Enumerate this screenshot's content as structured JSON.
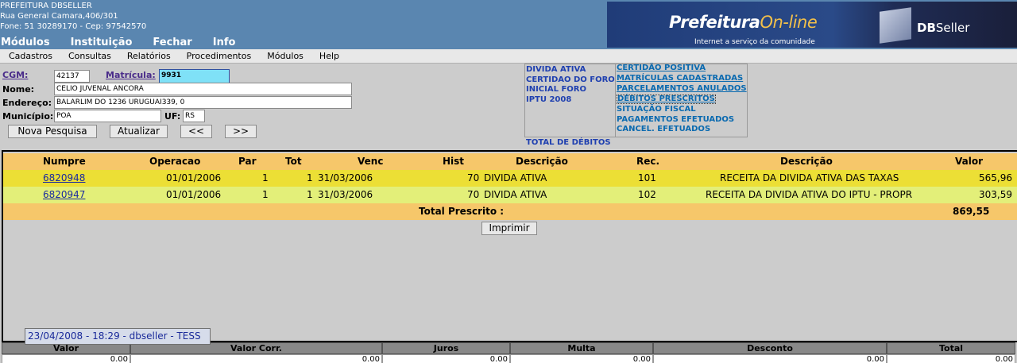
{
  "header": {
    "org_name": "PREFEITURA DBSELLER",
    "address": "Rua General Camara,406/301",
    "contact": "Fone: 51 30289170  -  Cep: 97542570",
    "menu": [
      "Módulos",
      "Instituição",
      "Fechar",
      "Info"
    ],
    "banner_logo_main": "Prefeitura",
    "banner_logo_accent": "On-line",
    "banner_tagline": "Internet a serviço da comunidade",
    "banner_brand_bold": "DB",
    "banner_brand_rest": "Seller"
  },
  "menubar": [
    "Cadastros",
    "Consultas",
    "Relatórios",
    "Procedimentos",
    "Módulos",
    "Help"
  ],
  "form": {
    "cgm_label": "CGM:",
    "cgm_value": "42137",
    "matricula_label": "Matrícula:",
    "matricula_value": "9931",
    "nome_label": "Nome:",
    "nome_value": "CELIO JUVENAL ANCORA",
    "endereco_label": "Endereço:",
    "endereco_value": "BALARLIM DO 1236 URUGUAI339, 0",
    "municipio_label": "Município:",
    "municipio_value": "POA",
    "uf_label": "UF:",
    "uf_value": "RS",
    "btn_nova": "Nova Pesquisa",
    "btn_atualizar": "Atualizar",
    "btn_prev": "<<",
    "btn_next": ">>"
  },
  "side": {
    "left_links": [
      "DIVIDA ATIVA",
      "CERTIDAO DO FORO",
      "INICIAL FORO",
      "IPTU 2008"
    ],
    "right_links": [
      "CERTIDÃO POSITIVA",
      "MATRÍCULAS CADASTRADAS",
      "PARCELAMENTOS ANULADOS",
      "DÉBITOS PRESCRITOS",
      "SITUAÇÃO FISCAL",
      "PAGAMENTOS EFETUADOS",
      "CANCEL. EFETUADOS"
    ],
    "total_debitos": "TOTAL DE DÉBITOS"
  },
  "table": {
    "headers": [
      "Numpre",
      "Operacao",
      "Par",
      "Tot",
      "Venc",
      "Hist",
      "Descrição",
      "Rec.",
      "Descrição",
      "Valor"
    ],
    "rows": [
      [
        "6820948",
        "01/01/2006",
        "1",
        "1",
        "31/03/2006",
        "70",
        "DIVIDA ATIVA",
        "101",
        "RECEITA DA DIVIDA ATIVA DAS TAXAS",
        "565,96"
      ],
      [
        "6820947",
        "01/01/2006",
        "1",
        "1",
        "31/03/2006",
        "70",
        "DIVIDA ATIVA",
        "102",
        "RECEITA DA DIVIDA ATIVA DO IPTU - PROPR",
        "303,59"
      ]
    ],
    "total_label": "Total Prescrito :",
    "total_value": "869,55"
  },
  "print_button": "Imprimir",
  "bottom": {
    "headers": [
      "Valor",
      "Valor Corr.",
      "Juros",
      "Multa",
      "Desconto",
      "Total"
    ],
    "values": [
      "0.00",
      "0.00",
      "0.00",
      "0.00",
      "0.00",
      "0.00"
    ]
  },
  "status": "23/04/2008 - 18:29 - dbseller - TESS"
}
